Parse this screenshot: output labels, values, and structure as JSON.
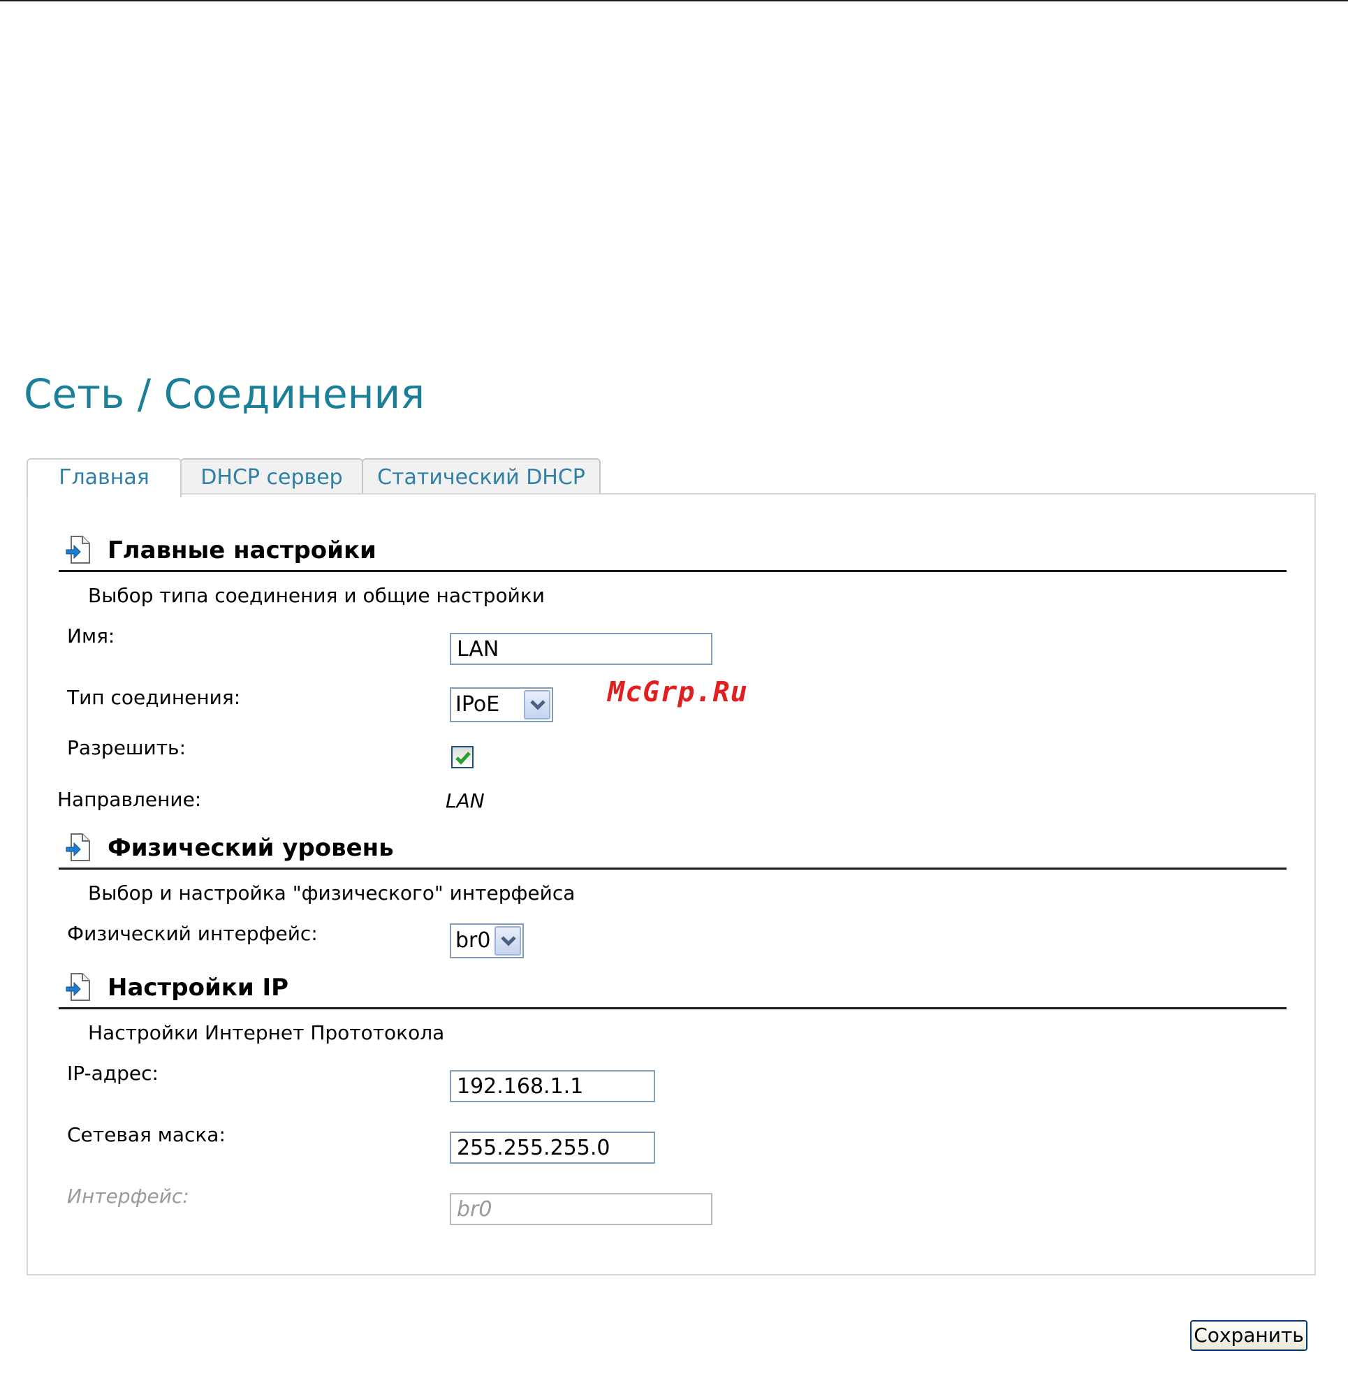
{
  "page": {
    "title": "Сеть / Соединения"
  },
  "tabs": [
    {
      "label": "Главная",
      "active": true
    },
    {
      "label": "DHCP сервер",
      "active": false
    },
    {
      "label": "Статический DHCP",
      "active": false
    }
  ],
  "sections": {
    "main": {
      "icon": "document-arrow-icon",
      "title": "Главные настройки",
      "description": "Выбор типа соединения и общие настройки",
      "fields": {
        "name": {
          "label": "Имя:",
          "value": "LAN"
        },
        "connection_type": {
          "label": "Тип соединения:",
          "value": "IPoE"
        },
        "enable": {
          "label": "Разрешить:",
          "checked": true
        },
        "direction": {
          "label": "Направление:",
          "value": "LAN"
        }
      }
    },
    "physical": {
      "icon": "document-arrow-icon",
      "title": "Физический уровень",
      "description": "Выбор и настройка \"физического\" интерфейса",
      "fields": {
        "interface": {
          "label": "Физический интерфейс:",
          "value": "br0"
        }
      }
    },
    "ip": {
      "icon": "document-arrow-icon",
      "title": "Настройки IP",
      "description": "Настройки Интернет Прототокола",
      "fields": {
        "ip_address": {
          "label": "IP-адрес:",
          "value": "192.168.1.1"
        },
        "netmask": {
          "label": "Сетевая маска:",
          "value": "255.255.255.0"
        },
        "interface": {
          "label": "Интерфейс:",
          "value": "br0",
          "disabled": true
        }
      }
    }
  },
  "watermark": "McGrp.Ru",
  "actions": {
    "save_label": "Сохранить"
  },
  "colors": {
    "title": "#1b7f99",
    "tab_text": "#2f7fa6",
    "check": "#2aa02a",
    "watermark": "#e02020"
  }
}
